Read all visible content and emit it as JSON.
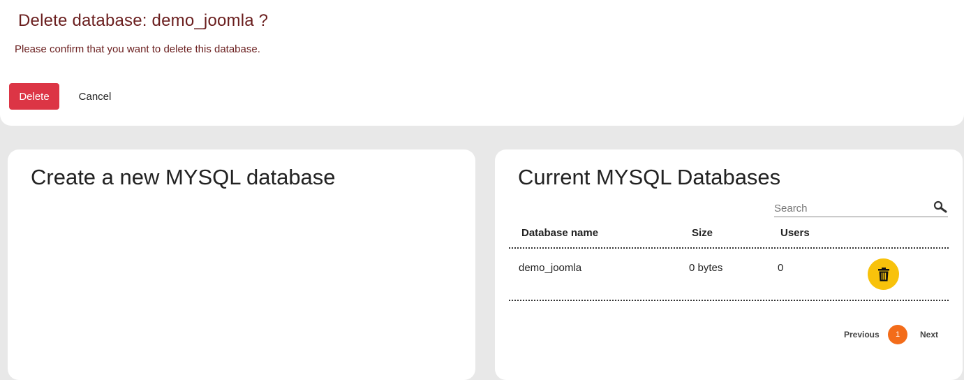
{
  "dialog": {
    "title": "Delete database: demo_joomla ?",
    "message": "Please confirm that you want to delete this database.",
    "delete_label": "Delete",
    "cancel_label": "Cancel"
  },
  "create_panel": {
    "title": "Create a new MYSQL database"
  },
  "databases_panel": {
    "title": "Current MYSQL Databases",
    "search_placeholder": "Search",
    "columns": [
      "Database name",
      "Size",
      "Users"
    ],
    "rows": [
      {
        "name": "demo_joomla",
        "size": "0 bytes",
        "users": "0"
      }
    ],
    "pagination": {
      "previous_label": "Previous",
      "current_page": "1",
      "next_label": "Next"
    }
  },
  "colors": {
    "delete_button": "#dc3545",
    "trash_button": "#f8c20b",
    "current_page": "#f36c1a",
    "dialog_text": "#6a1e1e"
  },
  "icons": {
    "search": "search-icon",
    "trash": "trash-icon"
  }
}
